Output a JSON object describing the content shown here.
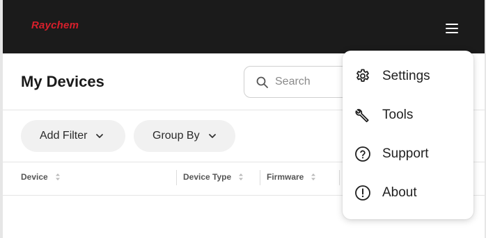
{
  "app": {
    "logo_text": "Raychem"
  },
  "header": {
    "menu_icon": "hamburger-menu-icon"
  },
  "page": {
    "title": "My Devices"
  },
  "search": {
    "placeholder": "Search",
    "value": ""
  },
  "filters": {
    "add_filter_label": "Add Filter",
    "group_by_label": "Group By"
  },
  "table": {
    "columns": [
      {
        "label": "Device"
      },
      {
        "label": "Device Type"
      },
      {
        "label": "Firmware"
      }
    ]
  },
  "menu": {
    "items": [
      {
        "label": "Settings",
        "icon": "gear-icon"
      },
      {
        "label": "Tools",
        "icon": "wrench-icon"
      },
      {
        "label": "Support",
        "icon": "question-circle-icon"
      },
      {
        "label": "About",
        "icon": "info-circle-icon"
      }
    ]
  },
  "colors": {
    "brand_red": "#d71f2b",
    "topbar": "#1b1b1b",
    "pill_bg": "#f1f1f1"
  }
}
